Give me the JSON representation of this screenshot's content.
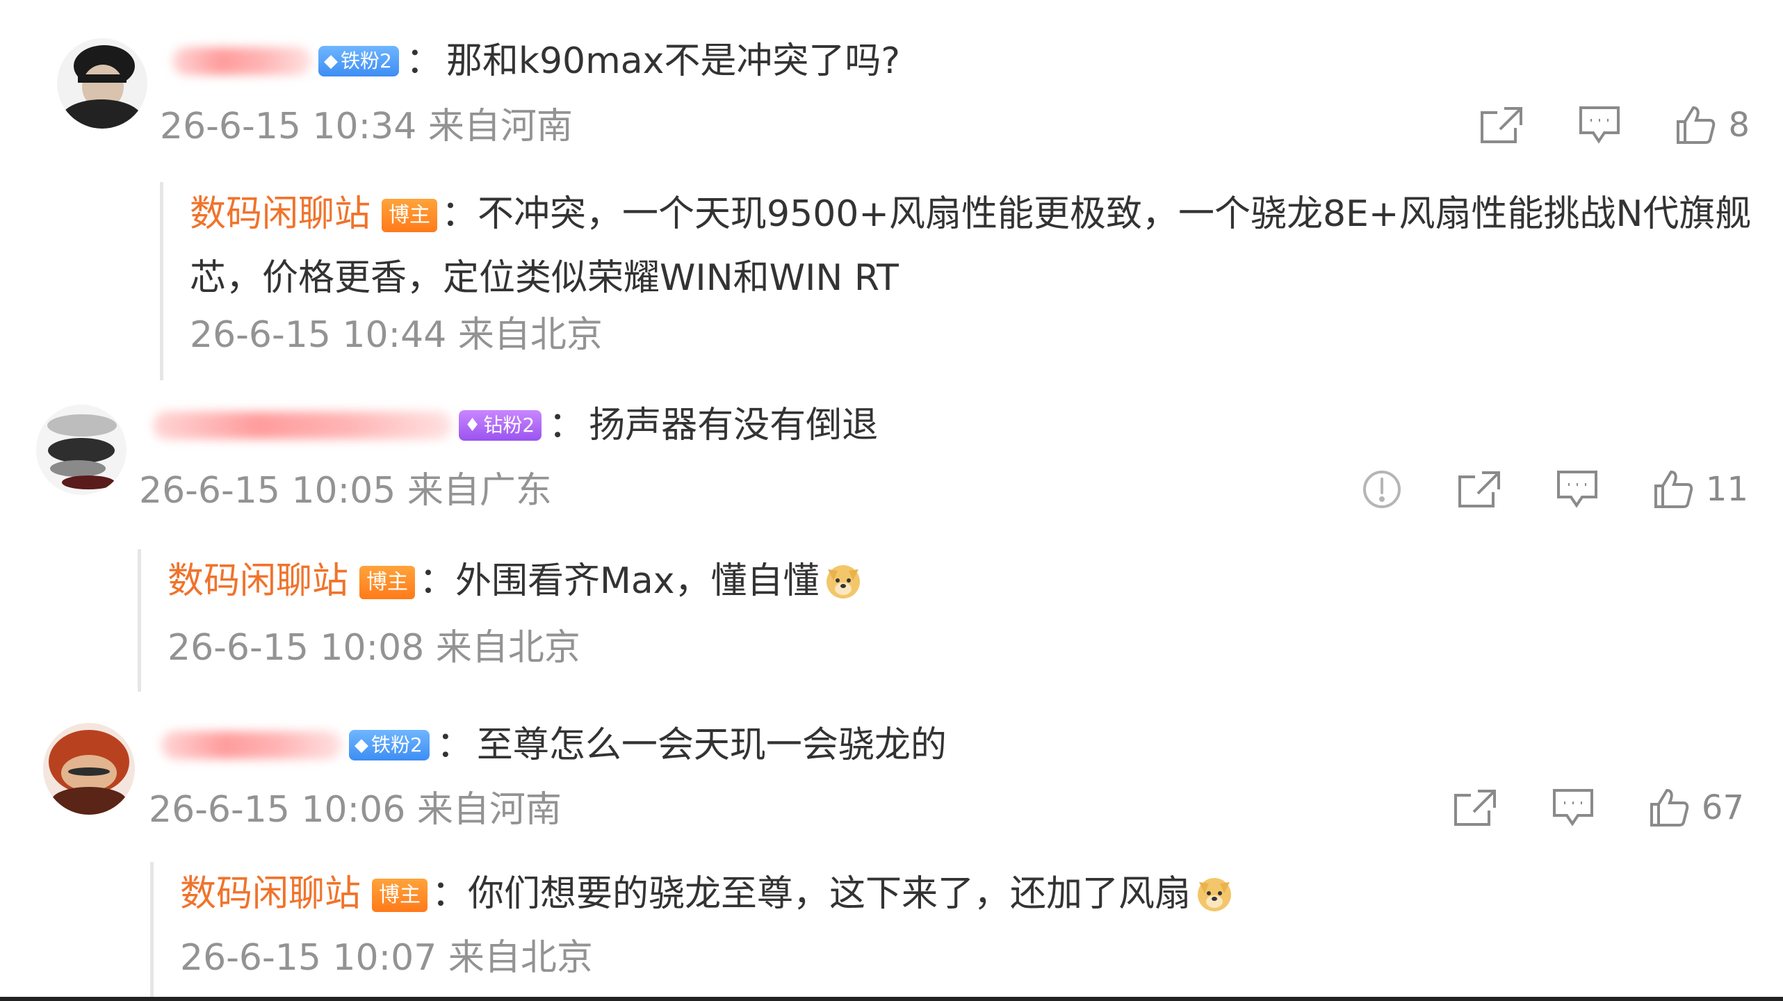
{
  "comments": [
    {
      "badge": "铁粉2",
      "text": "那和k90max不是冲突了吗?",
      "meta": "26-6-15 10:34 来自河南",
      "likes": "8",
      "reply": {
        "author": "数码闲聊站",
        "host_badge": "博主",
        "text": "不冲突，一个天玑9500+风扇性能更极致，一个骁龙8E+风扇性能挑战N代旗舰芯，价格更香，定位类似荣耀WIN和WIN RT",
        "meta": "26-6-15 10:44 来自北京"
      }
    },
    {
      "badge": "钻粉2",
      "text": "扬声器有没有倒退",
      "meta": "26-6-15 10:05 来自广东",
      "likes": "11",
      "reply": {
        "author": "数码闲聊站",
        "host_badge": "博主",
        "text": "外围看齐Max，懂自懂",
        "meta": "26-6-15 10:08 来自北京"
      }
    },
    {
      "badge": "铁粉2",
      "text": "至尊怎么一会天玑一会骁龙的",
      "meta": "26-6-15 10:06 来自河南",
      "likes": "67",
      "reply": {
        "author": "数码闲聊站",
        "host_badge": "博主",
        "text": "你们想要的骁龙至尊，这下来了，还加了风扇",
        "meta": "26-6-15 10:07 来自北京"
      }
    }
  ],
  "separator": "：",
  "icons": {
    "share": "share-icon",
    "reply": "comment-icon",
    "like": "thumbs-up-icon",
    "report": "report-icon",
    "emoji": "doge-emoji-icon",
    "badge_gem": "diamond-gem-icon"
  },
  "colors": {
    "author": "#f0732b",
    "host_badge": "#ff8a25",
    "meta": "#939393",
    "iron_badge": "#4a98f5",
    "diamond_badge": "#a862f3",
    "blurred_name": "#ff9c9c"
  }
}
